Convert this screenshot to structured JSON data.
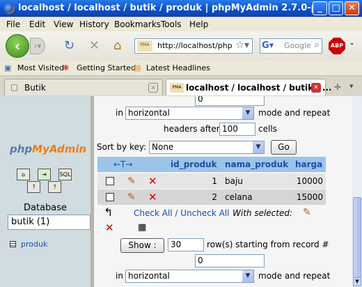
{
  "window": {
    "title": "localhost / localhost / butik / produk | phpMyAdmin 2.7.0-pl1 - ...",
    "min": "_",
    "max": "□",
    "close": "✕"
  },
  "menu": [
    "File",
    "Edit",
    "View",
    "History",
    "Bookmarks",
    "Tools",
    "Help"
  ],
  "nav": {
    "url": "http://localhost/php",
    "search_placeholder": "Google",
    "pma_icon_text": "PMA",
    "abp": "ABP"
  },
  "bookmarks": [
    "Most Visited",
    "Getting Started",
    "Latest Headlines"
  ],
  "tabs": [
    {
      "label": "Butik"
    },
    {
      "label": "localhost / localhost / butik / ..."
    }
  ],
  "left": {
    "logo_php": "php",
    "logo_myadmin": "MyAdmin",
    "database_label": "Database",
    "database_value": "butik (1)",
    "table_link": "produk"
  },
  "top_form": {
    "start_value": "0",
    "in_label": "in",
    "mode_value": "horizontal",
    "mode_suffix": "mode and repeat",
    "headers_after": "headers after",
    "repeat_value": "100",
    "cells": "cells"
  },
  "sort": {
    "label": "Sort by key:",
    "value": "None",
    "go": "Go"
  },
  "table": {
    "arrows": "←T→",
    "columns": [
      "id_produk",
      "nama_produk",
      "harga"
    ],
    "rows": [
      {
        "id_produk": "1",
        "nama_produk": "baju",
        "harga": "10000"
      },
      {
        "id_produk": "2",
        "nama_produk": "celana",
        "harga": "15000"
      }
    ]
  },
  "actions": {
    "check_all": "Check All / Uncheck All",
    "with_selected": "With selected:"
  },
  "bottom_form": {
    "show_label": "Show :",
    "rows_value": "30",
    "rows_text": "row(s) starting from record #",
    "start_value": "0",
    "in_label": "in",
    "mode_value": "horizontal",
    "mode_suffix": "mode and repeat"
  },
  "colors": {
    "header_bg": "#9cc4e8",
    "row_odd": "#e5e5e5",
    "row_even": "#d5d5d5",
    "link": "#1a4ea8",
    "left_bg": "#d0dce0"
  }
}
